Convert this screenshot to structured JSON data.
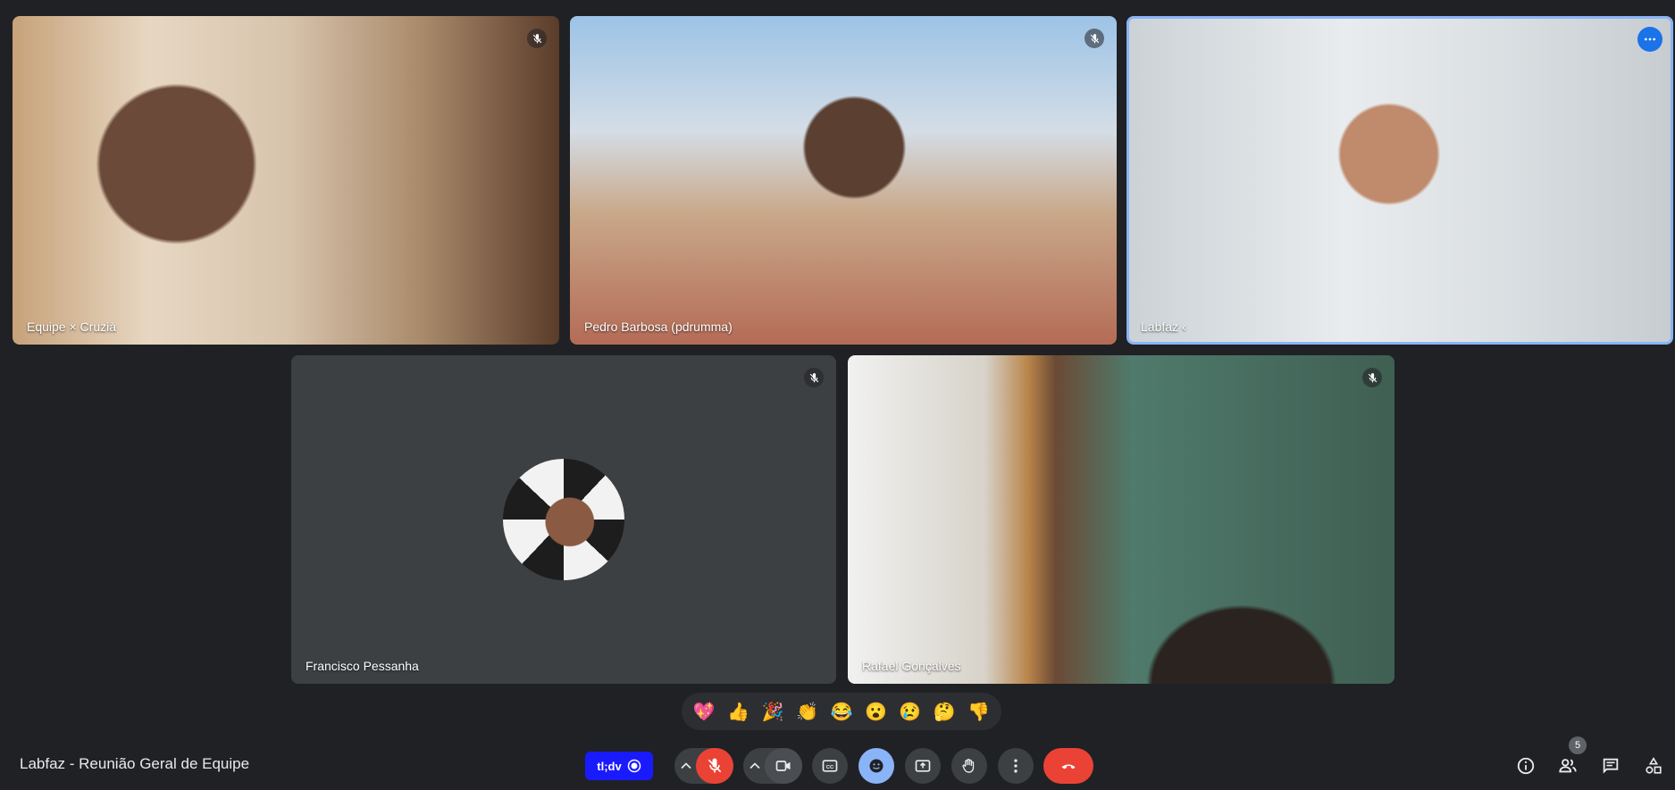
{
  "participants": [
    {
      "name": "Equipe × Cruzià",
      "muted": true
    },
    {
      "name": "Pedro Barbosa (pdrumma)",
      "muted": true
    },
    {
      "name": "Labfaz ‹",
      "muted": false,
      "speaking": true
    },
    {
      "name": "Francisco Pessanha",
      "muted": true
    },
    {
      "name": "Rafael Gonçalves",
      "muted": true
    }
  ],
  "reactions": [
    "💖",
    "👍",
    "🎉",
    "👏",
    "😂",
    "😮",
    "😢",
    "🤔",
    "👎"
  ],
  "meeting": {
    "title": "Labfaz - Reunião Geral de Equipe"
  },
  "toolbar": {
    "tldv_label": "tl;dv",
    "people_count": "5"
  },
  "colors": {
    "background": "#202124",
    "tile": "#3c4043",
    "mic_off": "#ea4335",
    "end_call": "#ea4335",
    "accent": "#8ab4f8",
    "tldv": "#1a1aff"
  }
}
